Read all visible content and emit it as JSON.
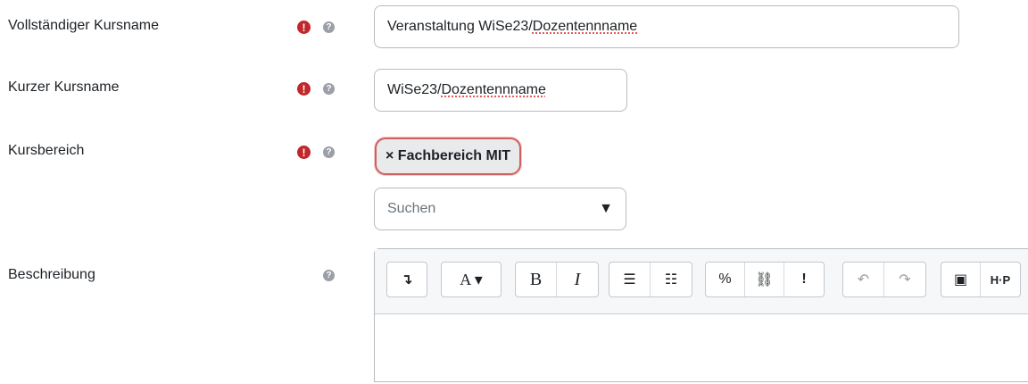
{
  "fields": {
    "fullname": {
      "label": "Vollständiger Kursname",
      "value_plain": "Veranstaltung WiSe23/",
      "value_flag": "Dozentennname"
    },
    "shortname": {
      "label": "Kurzer Kursname",
      "value_plain": "WiSe23/",
      "value_flag": "Dozentennname"
    },
    "category": {
      "label": "Kursbereich",
      "chip": "× Fachbereich MIT",
      "search_placeholder": "Suchen",
      "caret": "▼"
    },
    "description": {
      "label": "Beschreibung"
    }
  },
  "icons": {
    "required": "!",
    "help": "?"
  },
  "toolbar": {
    "show_more": "↴",
    "font": "A ▾",
    "bold": "B",
    "italic": "I",
    "bullet_list": "☰",
    "numbered_list": "☷",
    "link": "%",
    "unlink": "⛓",
    "emoji": "!",
    "undo": "↶",
    "redo": "↷",
    "image": "▣",
    "h5p": "H·P"
  }
}
